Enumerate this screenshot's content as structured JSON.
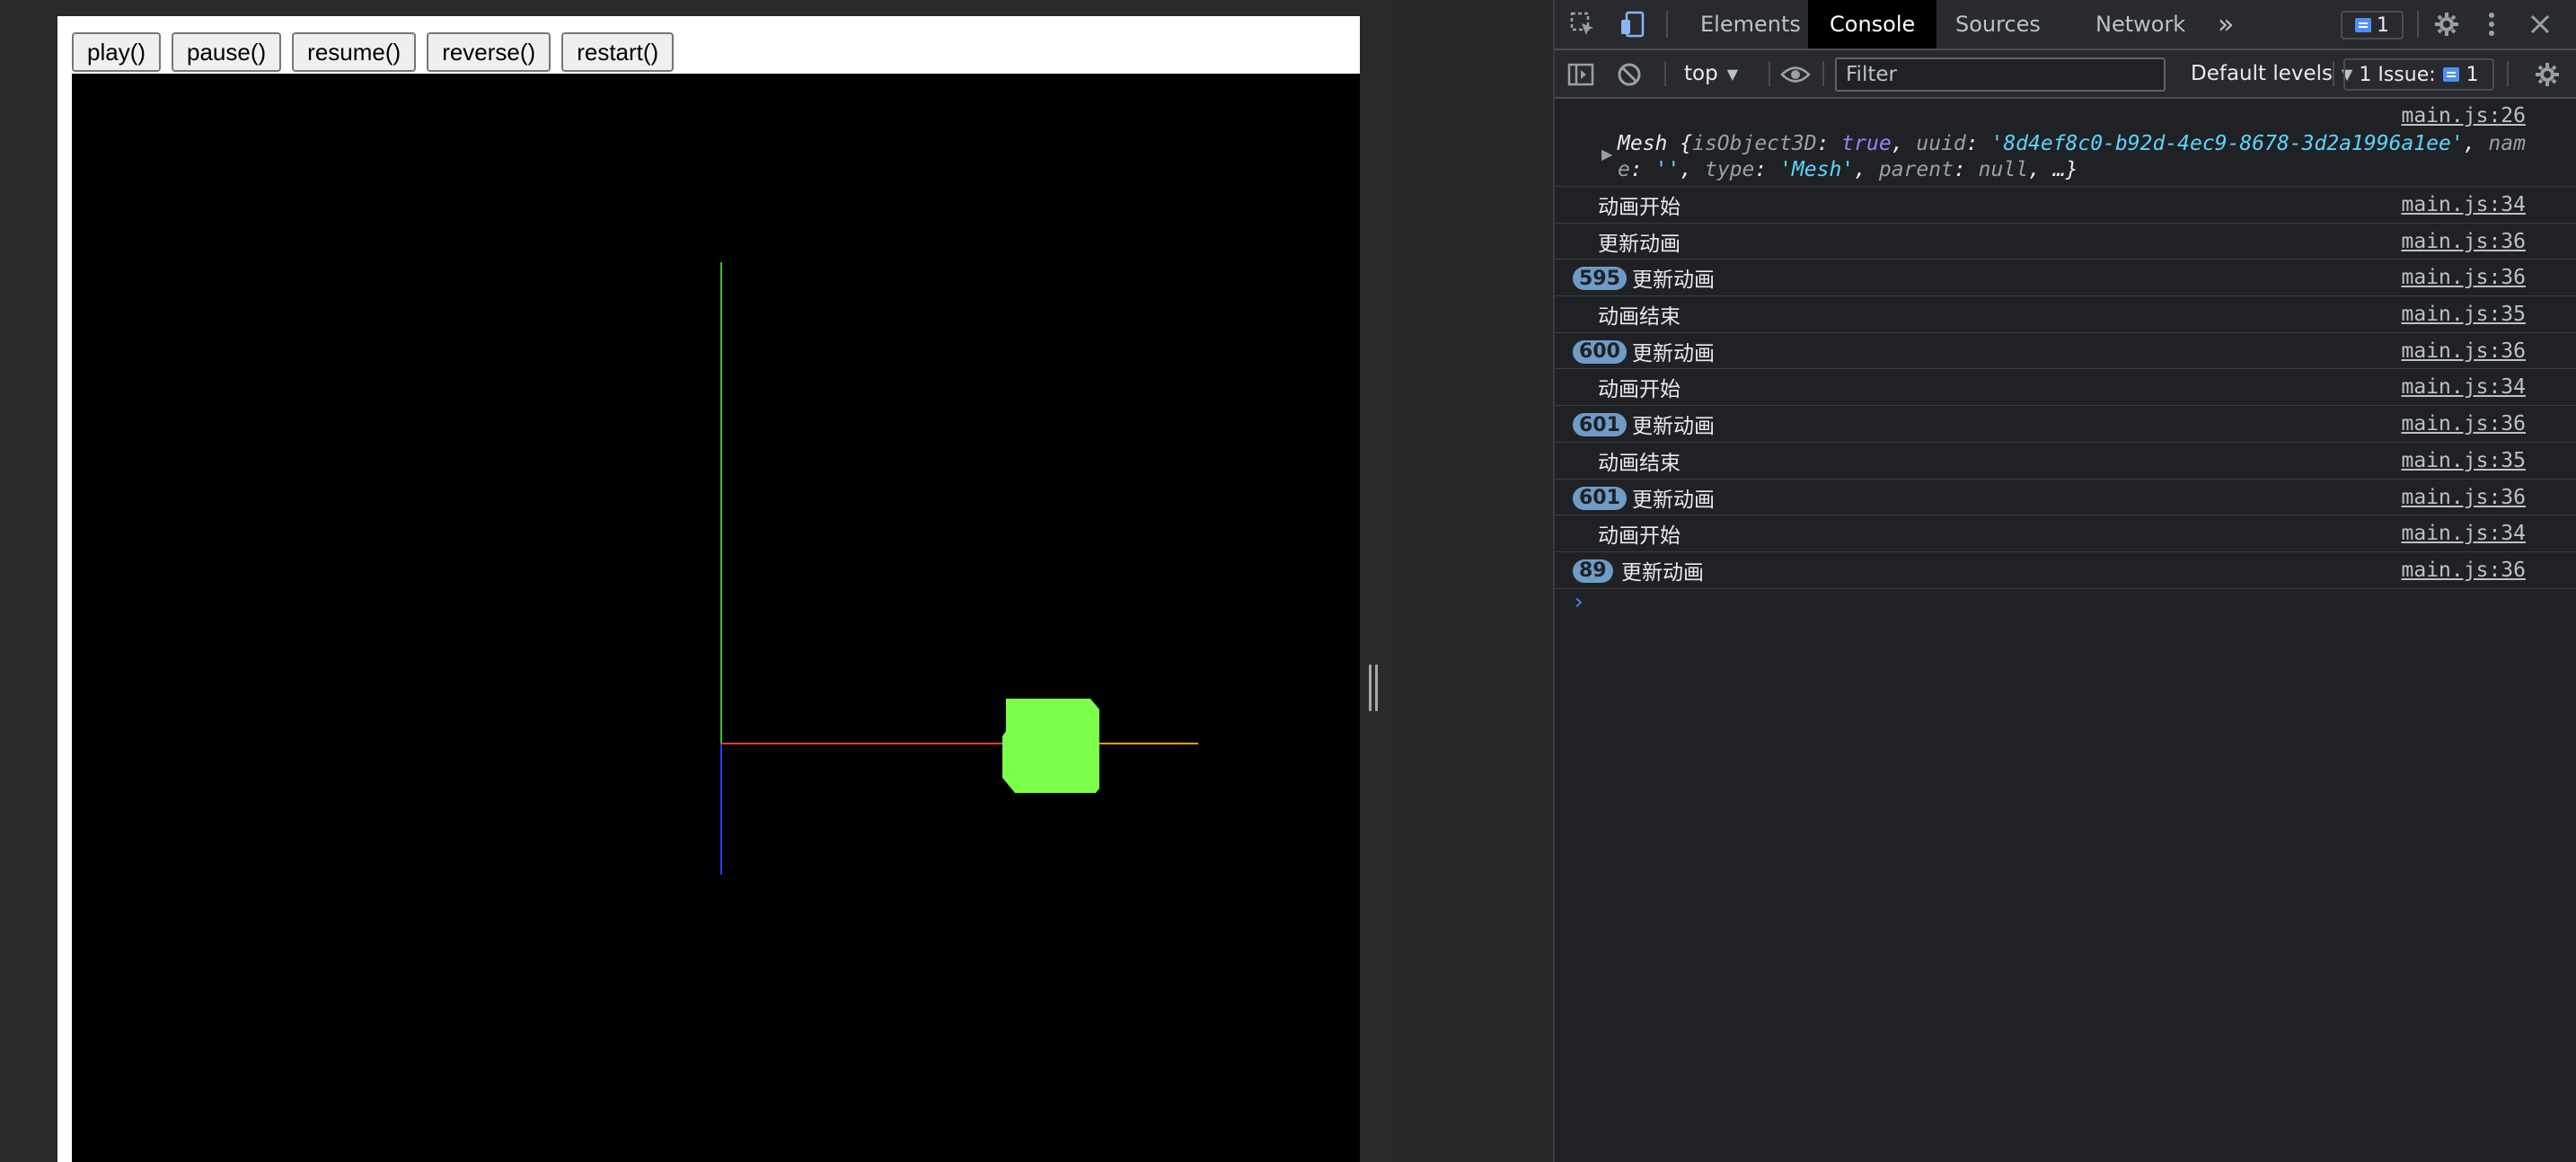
{
  "page": {
    "buttons": [
      "play()",
      "pause()",
      "resume()",
      "reverse()",
      "restart()"
    ]
  },
  "scene": {
    "colors": {
      "background": "#000000",
      "x_axis": "#ff3b2f",
      "x_axis_far": "#ff9a1a",
      "y_axis": "#3fbf2f",
      "z_axis": "#2a3cff",
      "cube": "#7bff4a"
    }
  },
  "devtools": {
    "tabs": [
      "Elements",
      "Console",
      "Sources",
      "Network"
    ],
    "active_tab": "Console",
    "overflow_label": "»",
    "messages_count": "1",
    "icons": {
      "inspect": "inspect-element-icon",
      "device": "device-toolbar-icon",
      "settings": "gear-icon",
      "more": "more-vertical-icon",
      "close": "close-icon",
      "sidebar": "console-sidebar-icon",
      "clear": "clear-console-icon",
      "eye": "live-expression-eye-icon"
    },
    "toolbar": {
      "context": "top",
      "filter_placeholder": "Filter",
      "levels": "Default levels",
      "issues_label": "1 Issue:",
      "issues_count": "1"
    },
    "console": {
      "object_entry": {
        "source": "main.js:26",
        "caret": "▶",
        "type": "Mesh",
        "k1": "isObject3D",
        "v1": "true",
        "k2": "uuid",
        "v2": "'8d4ef8c0-b92d-4ec9-8678-3d2a1996a1ee'",
        "k3": "name",
        "v3": "''",
        "k4": "type",
        "v4": "'Mesh'",
        "k5": "parent",
        "v5": "null",
        "tail": "…}"
      },
      "rows": [
        {
          "count": "",
          "text": "动画开始",
          "source": "main.js:34"
        },
        {
          "count": "",
          "text": "更新动画",
          "source": "main.js:36"
        },
        {
          "count": "595",
          "text": "更新动画",
          "source": "main.js:36"
        },
        {
          "count": "",
          "text": "动画结束",
          "source": "main.js:35"
        },
        {
          "count": "600",
          "text": "更新动画",
          "source": "main.js:36"
        },
        {
          "count": "",
          "text": "动画开始",
          "source": "main.js:34"
        },
        {
          "count": "601",
          "text": "更新动画",
          "source": "main.js:36"
        },
        {
          "count": "",
          "text": "动画结束",
          "source": "main.js:35"
        },
        {
          "count": "601",
          "text": "更新动画",
          "source": "main.js:36"
        },
        {
          "count": "",
          "text": "动画开始",
          "source": "main.js:34"
        },
        {
          "count": "89",
          "text": "更新动画",
          "source": "main.js:36"
        }
      ],
      "prompt": "›"
    }
  }
}
